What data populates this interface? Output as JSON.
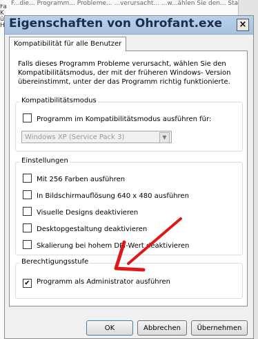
{
  "background": {
    "top_text": "F...die...   Programm...  Probleme...  ...verursacht...  ...w...ählen Sie den...   Stand...",
    "left_text": "Fa K ü H"
  },
  "dialog": {
    "title": "Eigenschaften von Ohrofant.exe",
    "close_glyph": "×",
    "tab_label": "Kompatibilität für alle Benutzer",
    "description": "Falls dieses Programm Probleme verursacht, wählen Sie den Kompatibilitätsmodus, der mit der früheren Windows- Version übereinstimmt, unter der das Programm richtig funktionierte.",
    "compat_group": {
      "label": "Kompatibilitätsmodus",
      "checkbox_label": "Programm im Kompatibilitätsmodus ausführen für:",
      "checked": false,
      "select_value": "Windows XP (Service Pack 3)"
    },
    "settings_group": {
      "label": "Einstellungen",
      "items": [
        {
          "label": "Mit 256 Farben ausführen",
          "checked": false
        },
        {
          "label": "In Bildschirmauflösung 640 x 480 ausführen",
          "checked": false
        },
        {
          "label": "Visuelle Designs deaktivieren",
          "checked": false
        },
        {
          "label": "Desktopgestaltung deaktivieren",
          "checked": false
        },
        {
          "label": "Skalierung bei hohem DPI-Wert deaktivieren",
          "checked": false
        }
      ]
    },
    "privilege_group": {
      "label": "Berechtigungsstufe",
      "checkbox_label": "Programm als Administrator ausführen",
      "checked": true
    },
    "buttons": {
      "ok": "OK",
      "cancel": "Abbrechen",
      "apply": "Übernehmen"
    }
  },
  "colors": {
    "annotation_arrow": "#e01818",
    "titlebar": "#b9d1ea"
  }
}
